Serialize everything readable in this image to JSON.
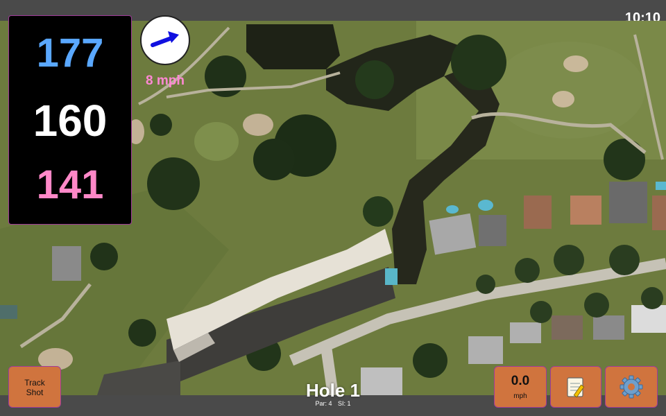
{
  "status_bar": {
    "time": "10:10"
  },
  "distances": {
    "back": "177",
    "middle": "160",
    "front": "141"
  },
  "wind": {
    "speed": "8 mph",
    "direction_icon": "arrow-icon",
    "arrow_color": "#1010e0"
  },
  "hole": {
    "title": "Hole 1",
    "par": "Par: 4",
    "stroke_index": "SI: 1"
  },
  "buttons": {
    "track_shot_line1": "Track",
    "track_shot_line2": "Shot",
    "speed_value": "0.0",
    "speed_unit": "mph",
    "notes_icon": "notepad-icon",
    "settings_icon": "gear-icon"
  },
  "colors": {
    "back_distance": "#5aa8ff",
    "middle_distance": "#ffffff",
    "front_distance": "#ff88c8",
    "button": "#d0743e",
    "accent_border": "#a03a9a"
  }
}
